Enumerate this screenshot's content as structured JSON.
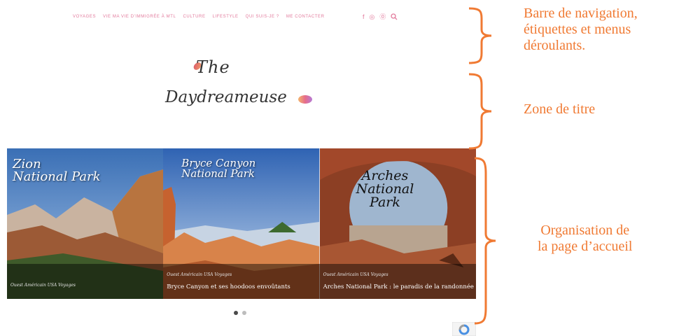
{
  "nav": {
    "items": [
      "VOYAGES",
      "VIE MA VIE D'IMMIGRÉE À MTL",
      "CULTURE",
      "LIFESTYLE",
      "QUI SUIS-JE ?",
      "ME CONTACTER"
    ]
  },
  "social": {
    "facebook": "f",
    "instagram": "◎",
    "pinterest": "⓪"
  },
  "logo": {
    "line1": "The",
    "line2": "Daydreameuse"
  },
  "slides": [
    {
      "overlay_title": "Zion\nNational Park",
      "categories": "Ouest Américain  USA  Voyages",
      "post_title": ""
    },
    {
      "overlay_title": "Bryce Canyon\nNational Park",
      "categories": "Ouest Américain  USA  Voyages",
      "post_title": "Bryce Canyon et ses hoodoos envoûtants"
    },
    {
      "overlay_title": "Arches\nNational\nPark",
      "categories": "Ouest Américain  USA  Voyages",
      "post_title": "Arches National Park : le paradis de la randonnée"
    }
  ],
  "pagination": {
    "count": 2,
    "active": 1
  },
  "annotations": {
    "nav": "Barre de navigation,\nétiquettes et menus\ndéroulants.",
    "title": "Zone de titre",
    "home": "Organisation de\nla page d’accueil"
  },
  "colors": {
    "accent": "#e27a9c",
    "annotation": "#f07a33"
  }
}
